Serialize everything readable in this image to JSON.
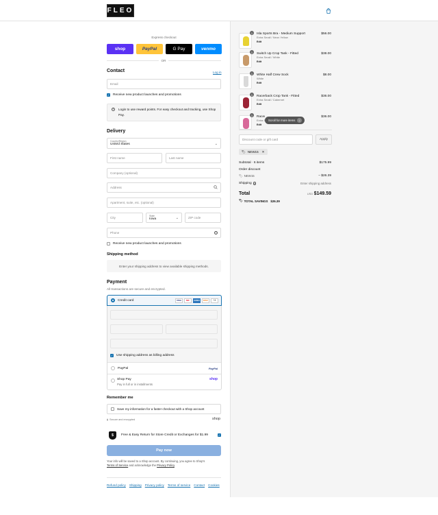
{
  "brand": {
    "logo": "FLEO"
  },
  "express": {
    "title": "Express checkout",
    "shop": "shop",
    "paypal": "PayPal",
    "gpay": "G Pay",
    "venmo": "venmo",
    "or": "OR"
  },
  "contact": {
    "title": "Contact",
    "login": "Log in",
    "email_placeholder": "Email",
    "news": "Receive new product launches and promotions",
    "info": "Login to use reward points. For easy checkout and tracking, use Shop Pay."
  },
  "delivery": {
    "title": "Delivery",
    "country_label": "Country/Region",
    "country": "United States",
    "first": "First name",
    "last": "Last name",
    "company": "Company (optional)",
    "address": "Address",
    "apt": "Apartment, suite, etc. (optional)",
    "city": "City",
    "state_label": "State",
    "state": "Iowa",
    "zip": "ZIP code",
    "phone": "Phone",
    "news": "Receive new product launches and promotions"
  },
  "shipping": {
    "title": "Shipping method",
    "msg": "Enter your shipping address to view available shipping methods."
  },
  "payment": {
    "title": "Payment",
    "subtitle": "All transactions are secure and encrypted.",
    "cc": "Credit card",
    "billing": "Use shipping address as billing address",
    "paypal": "PayPal",
    "paypal_logo": "PayPal",
    "shoppay": "Shop Pay",
    "shoppay_sub": "Pay in full or in installments",
    "shop_logo": "shop",
    "card_logos": [
      "VISA",
      "MC",
      "AMEX",
      "DISC",
      "+4"
    ]
  },
  "remember": {
    "title": "Remember me",
    "save": "Save my information for a faster checkout with a Shop account",
    "secure": "Secure and encrypted",
    "shop": "shop"
  },
  "returns": {
    "text": "Free & Easy Return for Store Credit or Exchanges for $1.99"
  },
  "pay": {
    "label": "Pay now"
  },
  "legal": {
    "line1": "Your info will be saved to a Shop account. By continuing, you agree to Shop's",
    "tos": "Terms of Service",
    "and": "and acknowledge the",
    "privacy": "Privacy Policy",
    "end": "."
  },
  "footer": [
    "Refund policy",
    "Shipping",
    "Privacy policy",
    "Terms of service",
    "Contact",
    "Cookies"
  ],
  "items": [
    {
      "name": "Isla Sports Bra - Medium Support",
      "variant": "Extra Small / Neon Yellow",
      "tag": "Edit",
      "price": "$56.00",
      "qty": "1",
      "color": "#e8d233"
    },
    {
      "name": "Switch Up Crop Tank - Fitted",
      "variant": "Extra Small / White",
      "tag": "Edit",
      "price": "$38.00",
      "qty": "1",
      "color": "#c89a6a"
    },
    {
      "name": "White Half Crew Sock",
      "variant": "White",
      "tag": "Edit",
      "price": "$8.00",
      "qty": "1",
      "color": "#d9d9d9"
    },
    {
      "name": "Racerback Crop Tank - Fitted",
      "variant": "Extra Small / Cabernet",
      "tag": "Edit",
      "price": "$36.00",
      "qty": "1",
      "color": "#9b2335"
    },
    {
      "name": "Racerback Crop Tank - Fitted",
      "variant": "Extra Small / Pink",
      "tag": "Edit",
      "price": "$36.00",
      "qty": "1",
      "color": "#d86a9a"
    }
  ],
  "scroll_hint": "Scroll for more items",
  "discount": {
    "placeholder": "Discount code or gift card",
    "apply": "Apply",
    "code": "NEW15"
  },
  "summary": {
    "subtotal_label": "Subtotal · 6 items",
    "subtotal": "$175.99",
    "order_discount": "Order discount",
    "code": "NEW15",
    "discount": "– $26.39",
    "shipping_label": "Shipping",
    "shipping": "Enter shipping address",
    "total_label": "Total",
    "currency": "USD",
    "total": "$149.59",
    "savings_label": "TOTAL SAVINGS",
    "savings": "$26.39"
  }
}
